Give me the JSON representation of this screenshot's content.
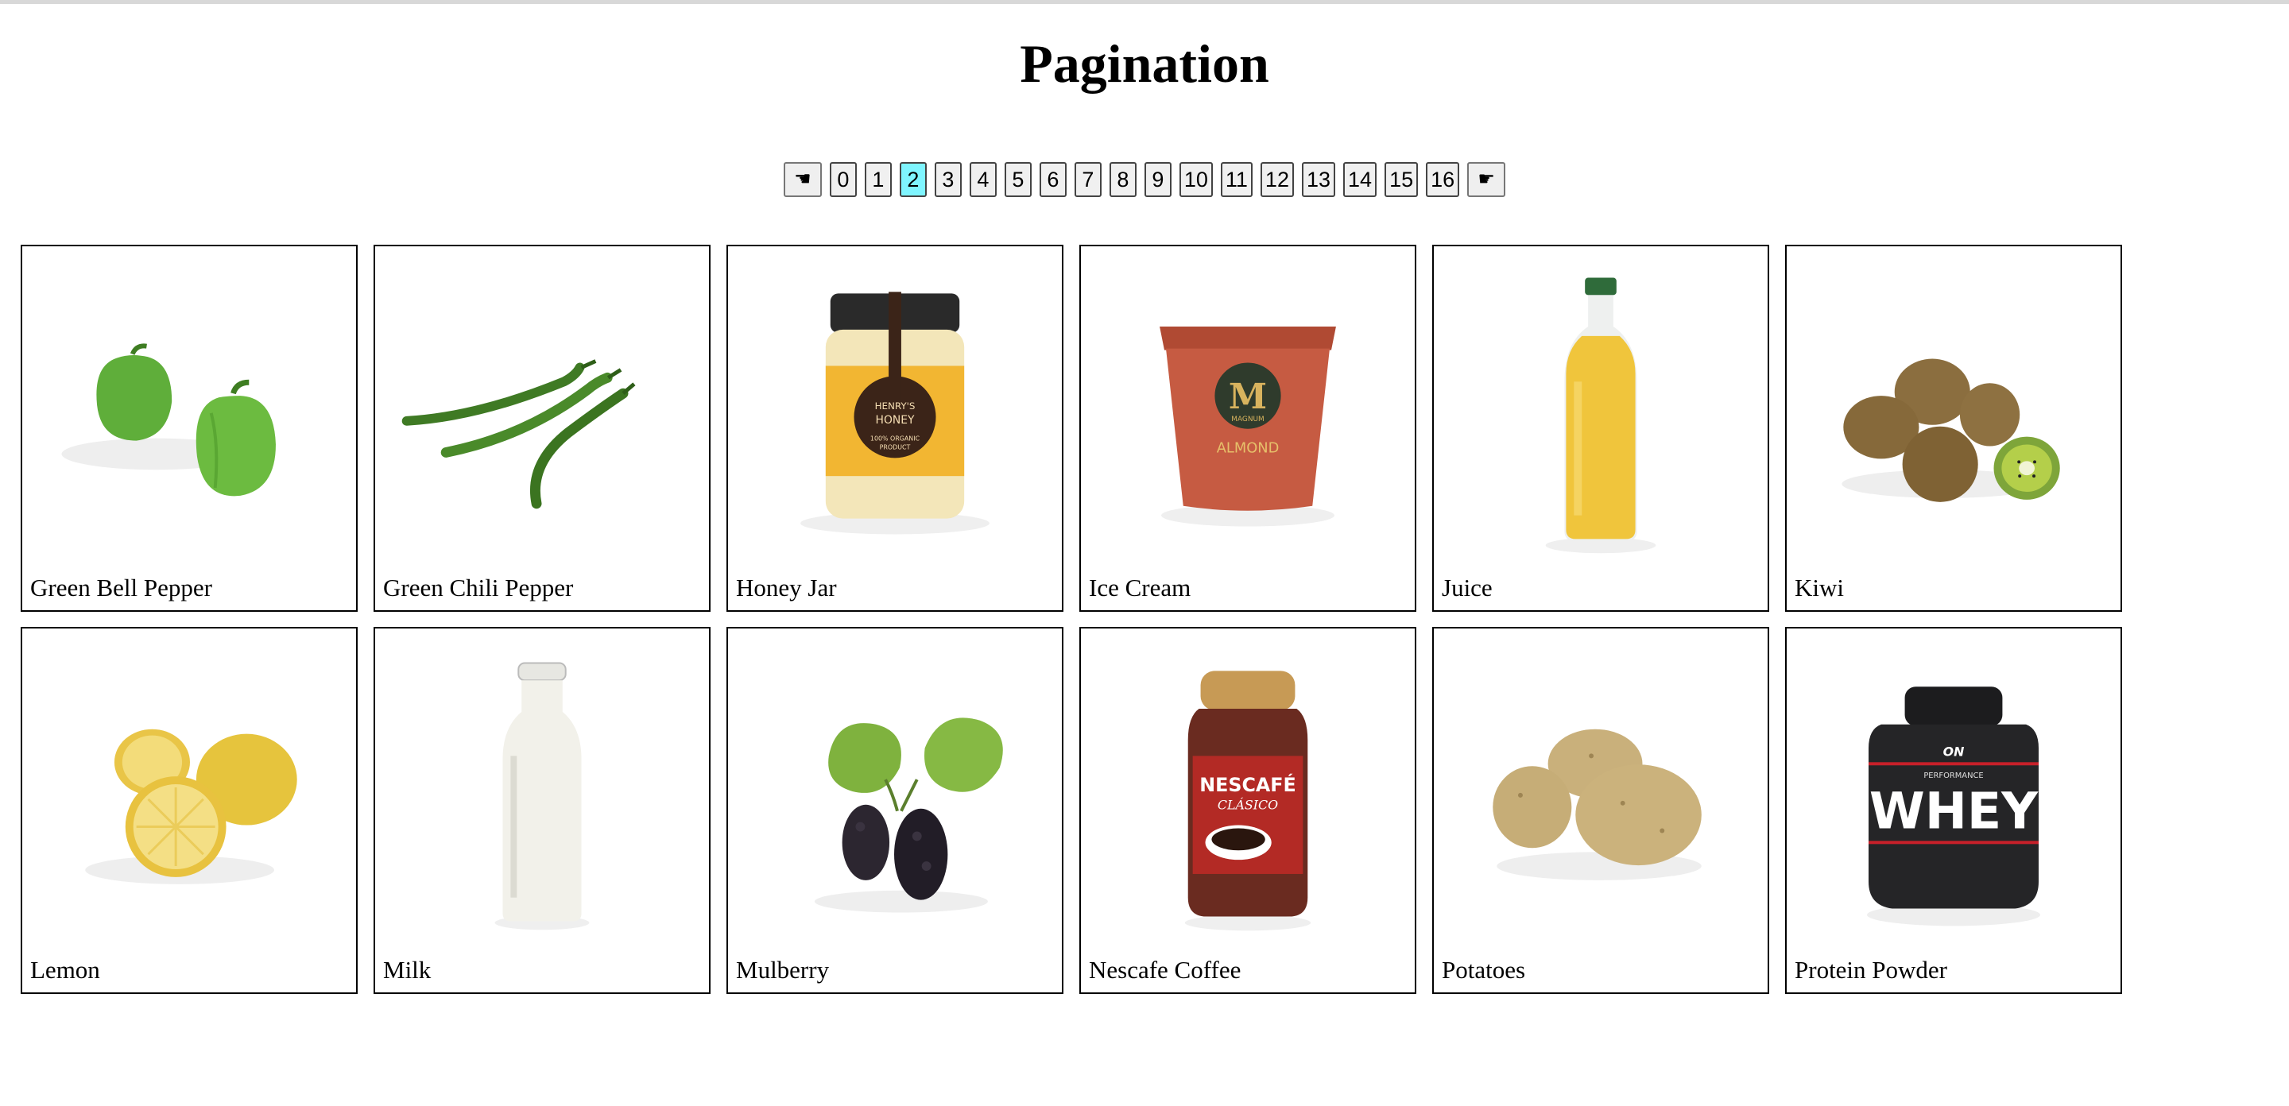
{
  "page": {
    "title": "Pagination"
  },
  "pagination": {
    "prev_icon": "pointing-left-icon",
    "prev_glyph": "☚",
    "next_icon": "pointing-right-icon",
    "next_glyph": "☛",
    "pages": [
      "0",
      "1",
      "2",
      "3",
      "4",
      "5",
      "6",
      "7",
      "8",
      "9",
      "10",
      "11",
      "12",
      "13",
      "14",
      "15",
      "16"
    ],
    "current_page": "2",
    "active_color": "#7ff5ff"
  },
  "products": [
    {
      "name": "Green Bell Pepper",
      "image": "green-bell-pepper-image"
    },
    {
      "name": "Green Chili Pepper",
      "image": "green-chili-pepper-image"
    },
    {
      "name": "Honey Jar",
      "image": "honey-jar-image",
      "label_lines": [
        "HENRY'S",
        "HONEY",
        "100% ORGANIC",
        "PRODUCT"
      ]
    },
    {
      "name": "Ice Cream",
      "image": "ice-cream-image",
      "label_lines": [
        "M",
        "MAGNUM",
        "ALMOND"
      ]
    },
    {
      "name": "Juice",
      "image": "juice-bottle-image"
    },
    {
      "name": "Kiwi",
      "image": "kiwi-image"
    },
    {
      "name": "Lemon",
      "image": "lemon-image"
    },
    {
      "name": "Milk",
      "image": "milk-bottle-image"
    },
    {
      "name": "Mulberry",
      "image": "mulberry-image"
    },
    {
      "name": "Nescafe Coffee",
      "image": "nescafe-coffee-jar-image",
      "label_lines": [
        "NESCAFÉ",
        "CLÁSICO"
      ]
    },
    {
      "name": "Potatoes",
      "image": "potatoes-image"
    },
    {
      "name": "Protein Powder",
      "image": "protein-powder-tub-image",
      "label_lines": [
        "ON",
        "PERFORMANCE",
        "WHEY"
      ]
    }
  ]
}
